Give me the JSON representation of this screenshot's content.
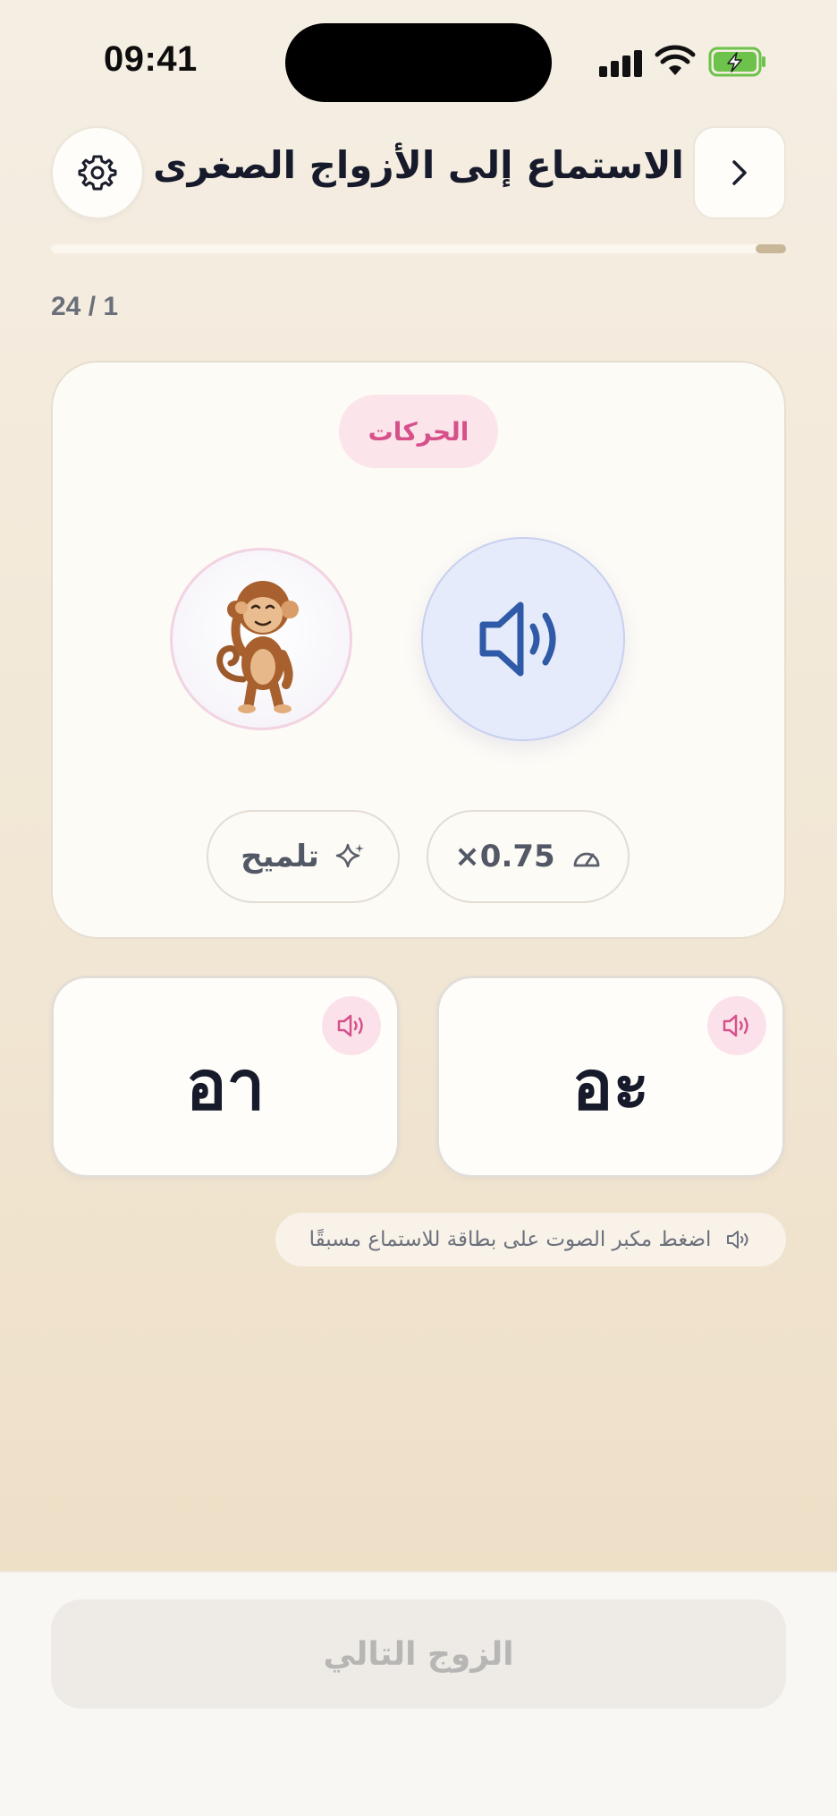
{
  "status_bar": {
    "time": "09:41",
    "battery_color": "#6cc24a"
  },
  "header": {
    "title": "الاستماع إلى الأزواج الصغرى",
    "settings_icon": "gear-icon",
    "back_icon": "chevron-right-icon"
  },
  "progress": {
    "counter": "24 / 1",
    "current": 1,
    "total": 24
  },
  "exercise": {
    "category": "الحركات",
    "mascot": "monkey-listening",
    "play_icon": "speaker-icon",
    "hint_label": "تلميح",
    "speed_label": "×0.75"
  },
  "answers": [
    {
      "text": "อา",
      "speaker_icon": "speaker-icon"
    },
    {
      "text": "อะ",
      "speaker_icon": "speaker-icon"
    }
  ],
  "tip": {
    "text": "اضغط مكبر الصوت على بطاقة للاستماع مسبقًا"
  },
  "footer": {
    "next_label": "الزوج التالي"
  },
  "colors": {
    "accent_pink": "#d6508a",
    "accent_blue": "#2f5aa8",
    "text_dark": "#161a2b"
  }
}
